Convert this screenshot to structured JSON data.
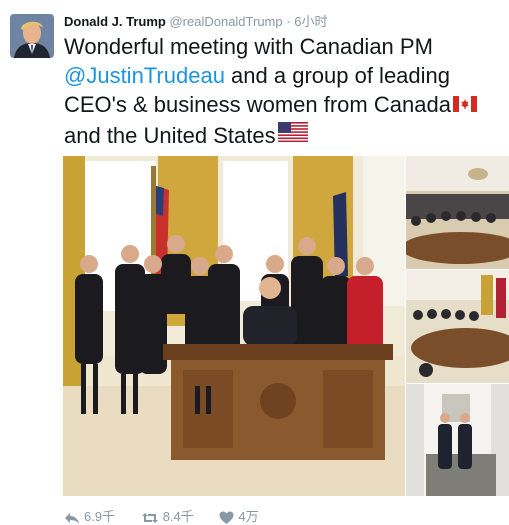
{
  "tweet": {
    "author_name": "Donald J. Trump",
    "handle": "@realDonaldTrump",
    "separator": "·",
    "time": "6小时",
    "text_before_mention": "Wonderful meeting with Canadian PM ",
    "mention": "@JustinTrudeau",
    "text_after_mention": " and a group of leading CEO's & business women from Canada",
    "text_end": "and the United States"
  },
  "icons": {
    "avatar": "avatar-photo",
    "flag_canada": "canada-flag-icon",
    "flag_us": "us-flag-icon",
    "reply": "reply-icon",
    "retweet": "retweet-icon",
    "like": "heart-icon"
  },
  "actions": {
    "reply_count": "6.9千",
    "retweet_count": "8.4千",
    "like_count": "4万"
  },
  "colors": {
    "link": "#1b95e0",
    "muted": "#8899a6",
    "text": "#14171a"
  }
}
